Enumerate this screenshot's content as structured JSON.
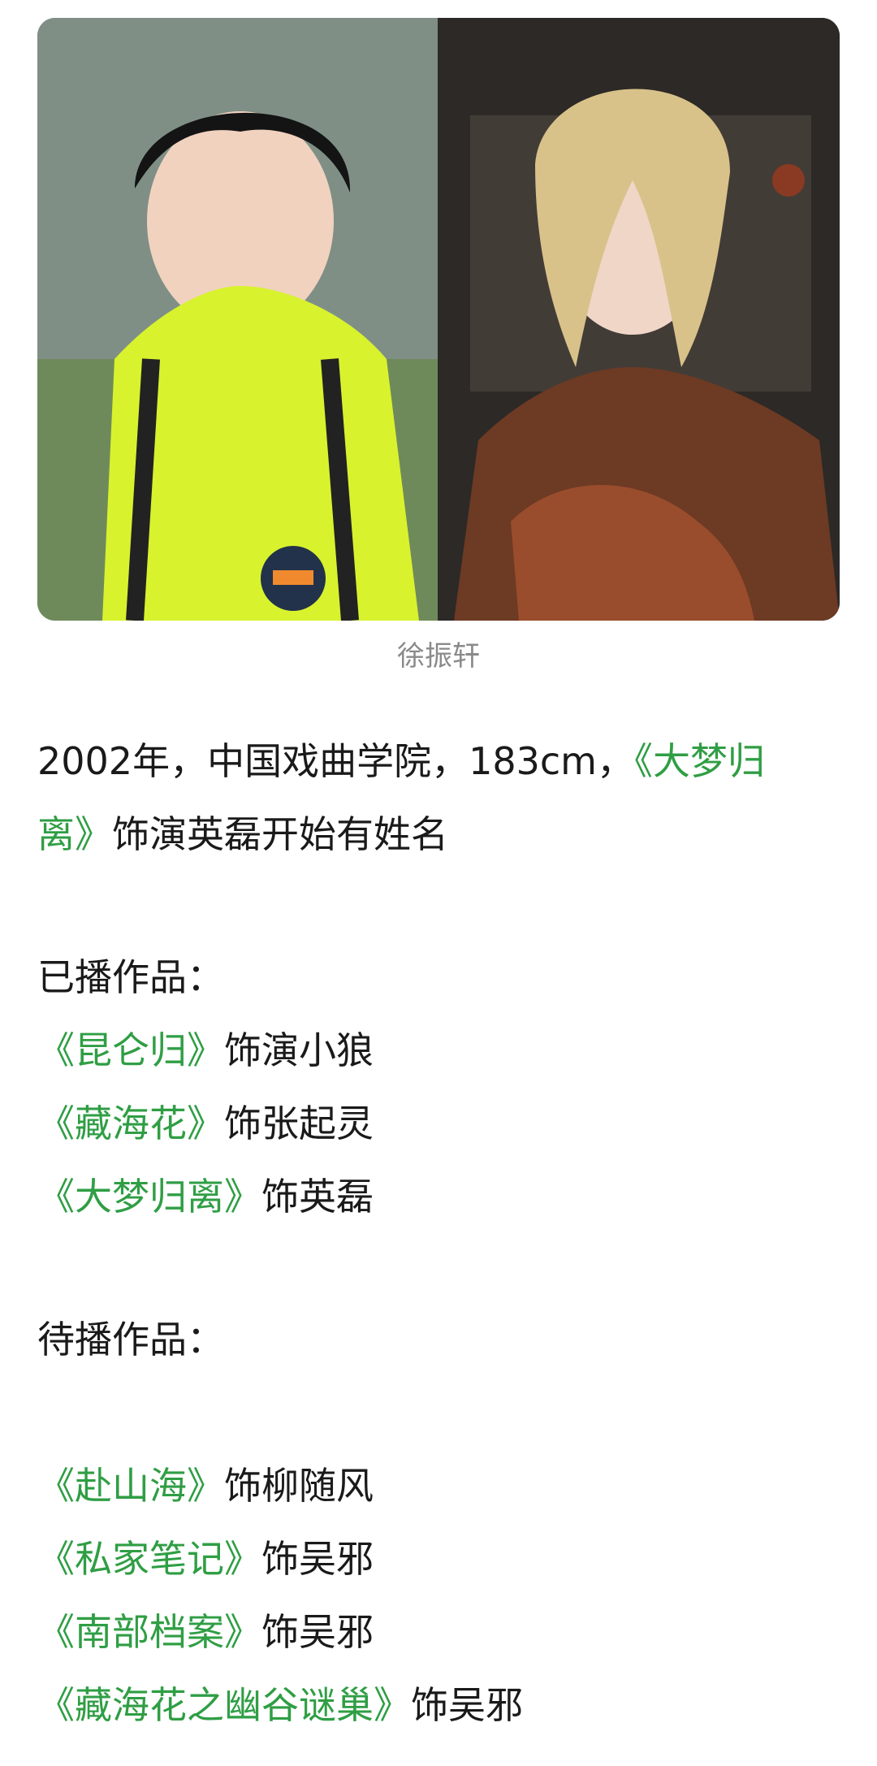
{
  "photos": {
    "left_alt": "portrait in yellow jacket",
    "right_alt": "portrait in costume"
  },
  "caption": "徐振轩",
  "intro": {
    "line1_prefix": "2002年，中国戏曲学院，183cm，",
    "line1_title": "《大梦归",
    "line2_title": "离》",
    "line2_suffix": "饰演英磊开始有姓名"
  },
  "aired": {
    "heading": "已播作品：",
    "items": [
      {
        "title": "《昆仑归》",
        "role": "饰演小狼"
      },
      {
        "title": "《藏海花》",
        "role": "饰张起灵"
      },
      {
        "title": "《大梦归离》",
        "role": "饰英磊"
      }
    ]
  },
  "upcoming": {
    "heading": "待播作品：",
    "items": [
      {
        "title": "《赴山海》",
        "role": "饰柳随风"
      },
      {
        "title": "《私家笔记》",
        "role": "饰吴邪"
      },
      {
        "title": "《南部档案》",
        "role": "饰吴邪"
      },
      {
        "title": "《藏海花之幽谷谜巢》",
        "role": "饰吴邪"
      }
    ]
  },
  "colors": {
    "link_green": "#2f9e44",
    "caption_gray": "#8a8a8a",
    "text": "#1a1a1a"
  }
}
